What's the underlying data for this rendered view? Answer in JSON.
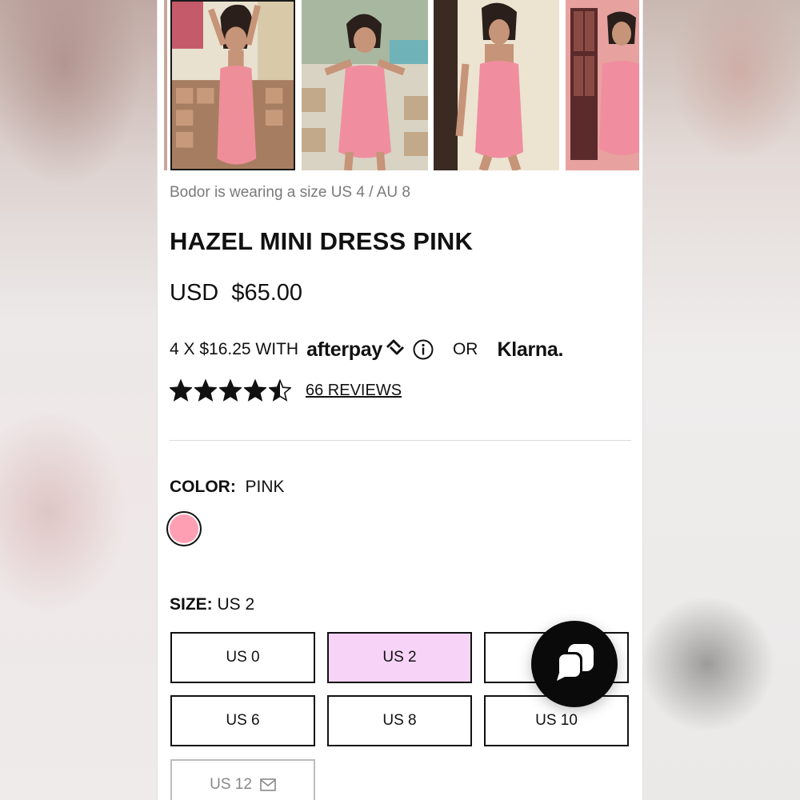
{
  "gallery": {
    "images": [
      {
        "icon": "model-photo-partial",
        "selected": false
      },
      {
        "icon": "model-photo-arms-raised",
        "selected": true
      },
      {
        "icon": "model-photo-seated",
        "selected": false
      },
      {
        "icon": "model-photo-side-cutout",
        "selected": false
      },
      {
        "icon": "model-photo-window",
        "selected": false
      }
    ]
  },
  "product": {
    "caption": "Bodor is wearing a size US 4 / AU 8",
    "title": "HAZEL MINI DRESS PINK",
    "price": "USD  $65.00"
  },
  "payments": {
    "installment_text": "4 X $16.25 WITH",
    "afterpay_label": "afterpay",
    "or_text": "OR",
    "klarna_label": "Klarna."
  },
  "rating": {
    "stars": 4.5,
    "max": 5,
    "reviews_label": "66 REVIEWS"
  },
  "color": {
    "label": "COLOR:",
    "value": "PINK",
    "swatch_hex": "#ff9fb4"
  },
  "size": {
    "label": "SIZE:",
    "value": "US 2",
    "options": [
      {
        "label": "US 0",
        "state": "available"
      },
      {
        "label": "US 2",
        "state": "selected"
      },
      {
        "label": "",
        "state": "available"
      },
      {
        "label": "US 6",
        "state": "available"
      },
      {
        "label": "US 8",
        "state": "available"
      },
      {
        "label": "US 10",
        "state": "available"
      },
      {
        "label": "US 12",
        "state": "out-of-stock"
      }
    ]
  },
  "chat": {
    "icon": "chat-bubbles-icon"
  },
  "colors": {
    "selected_size_bg": "#f7d4f7",
    "text": "#111111"
  }
}
